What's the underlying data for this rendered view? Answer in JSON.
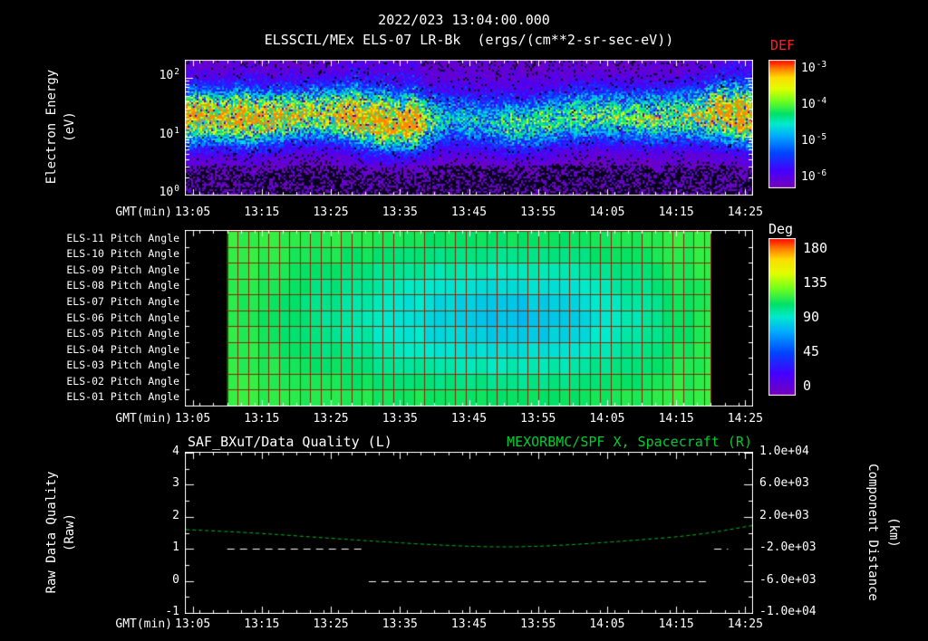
{
  "header": {
    "title": "2022/023 13:04:00.000"
  },
  "time_axis": {
    "label": "GMT(min)",
    "start_min": 784,
    "end_min": 866,
    "tick_labels": [
      "13:05",
      "13:15",
      "13:25",
      "13:35",
      "13:45",
      "13:55",
      "14:05",
      "14:15",
      "14:25"
    ],
    "tick_minutes": [
      785,
      795,
      805,
      815,
      825,
      835,
      845,
      855,
      865
    ]
  },
  "chart_data": [
    {
      "type": "heatmap",
      "name": "electron-energy-spectrogram",
      "title": "ELSSCIL/MEx ELS-07 LR-Bk  (ergs/(cm**2-sr-sec-eV))",
      "ylabel": "Electron Energy",
      "ylabel_units": "(eV)",
      "yscale": "log",
      "ylim_ev": [
        1,
        200
      ],
      "ytick_exponents": [
        2,
        1,
        0
      ],
      "colorbar": {
        "title": "DEF",
        "title_color": "#ff2222",
        "scale": "log",
        "tick_exponents": [
          -3,
          -4,
          -5,
          -6
        ]
      },
      "band_center_logev": 1.32,
      "band_sigma_logev": 0.3,
      "band_intensity_profile": [
        0.85,
        0.85,
        0.8,
        0.8,
        0.92,
        0.85,
        0.8,
        0.76,
        0.7,
        0.7,
        0.72,
        0.8,
        0.9,
        0.85,
        0.92,
        0.82,
        0.9,
        0.6,
        0.4,
        0.34,
        0.4,
        0.34,
        0.4,
        0.5,
        0.45,
        0.5,
        0.46,
        0.5,
        0.55,
        0.5,
        0.56,
        0.5,
        0.55,
        0.6,
        0.55,
        0.6,
        0.65,
        0.75,
        0.85,
        0.9,
        0.9
      ],
      "streak_profile": [
        0.3,
        0.3,
        0.28,
        0.3,
        0.5,
        0.32,
        0.3,
        0.28,
        0.2,
        0.2,
        0.25,
        0.4,
        0.8,
        0.6,
        0.85,
        0.5,
        0.9,
        0.3,
        0.35,
        0.35,
        0.38,
        0.33,
        0.36,
        0.4,
        0.3,
        0.32,
        0.3,
        0.28,
        0.25,
        0.25,
        0.26,
        0.24,
        0.26,
        0.28,
        0.25,
        0.28,
        0.3,
        0.5,
        0.8,
        0.9,
        0.85
      ]
    },
    {
      "type": "heatmap",
      "name": "pitch-angle-panels",
      "row_labels": [
        "ELS-11 Pitch Angle",
        "ELS-10 Pitch Angle",
        "ELS-09 Pitch Angle",
        "ELS-08 Pitch Angle",
        "ELS-07 Pitch Angle",
        "ELS-06 Pitch Angle",
        "ELS-05 Pitch Angle",
        "ELS-04 Pitch Angle",
        "ELS-03 Pitch Angle",
        "ELS-02 Pitch Angle",
        "ELS-01 Pitch Angle"
      ],
      "colorbar": {
        "title": "Deg",
        "ticks": [
          180,
          135,
          90,
          45,
          0
        ],
        "range": [
          0,
          180
        ]
      },
      "data_start_min": 790,
      "data_end_min": 860,
      "base_deg": 114,
      "center_profile_deg": [
        112,
        108,
        103,
        98,
        93,
        88,
        84,
        80,
        78,
        79,
        83,
        89,
        96,
        104,
        111
      ],
      "cell_minutes": 1.5
    },
    {
      "type": "line",
      "name": "quality-and-spacecraft-distance",
      "left_title": "SAF_BXuT/Data Quality (L)",
      "right_title": "MEXORBMC/SPF X, Spacecraft (R)",
      "right_title_color": "#00cc33",
      "left_ylabel": "Raw Data Quality",
      "left_ylabel_units": "(Raw)",
      "right_ylabel": "Component Distance",
      "right_ylabel_units": "(km)",
      "left_ylim": [
        -1,
        4
      ],
      "left_ticks": [
        4,
        3,
        2,
        1,
        0,
        -1
      ],
      "right_ylim_km": [
        -10000,
        10000
      ],
      "right_tick_labels": [
        "1.0e+04",
        "6.0e+03",
        "2.0e+03",
        "-2.0e+03",
        "-6.0e+03",
        "-1.0e+04"
      ],
      "series": [
        {
          "name": "spacecraft-x-distance",
          "axis": "right",
          "color": "#00bb22",
          "style": "dashed",
          "x_min": [
            784,
            792,
            802,
            812,
            822,
            830,
            838,
            848,
            858,
            866
          ],
          "y_km": [
            400,
            100,
            -500,
            -1100,
            -1600,
            -1800,
            -1600,
            -1000,
            -300,
            900
          ]
        },
        {
          "name": "raw-data-quality",
          "axis": "left",
          "color": "#ffffff",
          "style": "dashed",
          "segments": [
            {
              "value": 1,
              "t0": 790,
              "t1": 809.5
            },
            {
              "value": 0,
              "t0": 810.5,
              "t1": 859.5
            },
            {
              "value": 1,
              "t0": 860.5,
              "t1": 862.5
            }
          ]
        }
      ]
    }
  ]
}
